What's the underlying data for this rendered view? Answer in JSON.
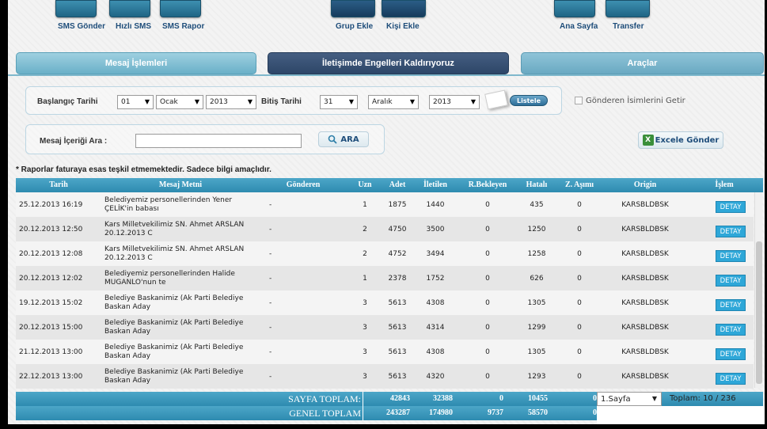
{
  "toolbar": {
    "sms_gonder": "SMS Gönder",
    "hizli_sms": "Hızlı SMS",
    "sms_rapor": "SMS Rapor",
    "grup_ekle": "Grup Ekle",
    "kisi_ekle": "Kişi Ekle",
    "ana_sayfa": "Ana Sayfa",
    "transfer": "Transfer"
  },
  "tabs": [
    {
      "label": "Mesaj İşlemleri"
    },
    {
      "label": "İletişimde Engelleri Kaldırıyoruz"
    },
    {
      "label": "Araçlar"
    }
  ],
  "filter": {
    "start_label": "Başlangıç Tarihi",
    "start_day": "01",
    "start_month": "Ocak",
    "start_year": "2013",
    "end_label": "Bitiş Tarihi",
    "end_day": "31",
    "end_month": "Aralık",
    "end_year": "2013",
    "list_button": "Listele",
    "sender_names_label": "Gönderen İsimlerini Getir",
    "search_label": "Mesaj İçeriği Ara :",
    "search_value": "",
    "search_button": "ARA",
    "excel_button": "Excele Gönder"
  },
  "note": "* Raporlar faturaya esas teşkil etmemektedir. Sadece bilgi amaçlıdır.",
  "table": {
    "headers": [
      "Tarih",
      "Mesaj Metni",
      "Gönderen",
      "Uzn",
      "Adet",
      "İletilen",
      "R.Bekleyen",
      "Hatalı",
      "Z. Aşımı",
      "Origin",
      "İşlem"
    ],
    "rows": [
      {
        "tarih": "25.12.2013 16:19",
        "mesaj": "Belediyemiz personellerinden Yener ÇELİK'in babası",
        "gonderen": "-",
        "uzn": "1",
        "adet": "1875",
        "iletilen": "1440",
        "bekleyen": "0",
        "hatali": "435",
        "zasimi": "0",
        "origin": "KARSBLDBSK",
        "islem": "DETAY"
      },
      {
        "tarih": "20.12.2013 12:50",
        "mesaj": "Kars Milletvekilimiz SN. Ahmet ARSLAN 20.12.2013 C",
        "gonderen": "-",
        "uzn": "2",
        "adet": "4750",
        "iletilen": "3500",
        "bekleyen": "0",
        "hatali": "1250",
        "zasimi": "0",
        "origin": "KARSBLDBSK",
        "islem": "DETAY"
      },
      {
        "tarih": "20.12.2013 12:08",
        "mesaj": "Kars Milletvekilimiz SN. Ahmet ARSLAN 20.12.2013 C",
        "gonderen": "-",
        "uzn": "2",
        "adet": "4752",
        "iletilen": "3494",
        "bekleyen": "0",
        "hatali": "1258",
        "zasimi": "0",
        "origin": "KARSBLDBSK",
        "islem": "DETAY"
      },
      {
        "tarih": "20.12.2013 12:02",
        "mesaj": "Belediyemiz personellerinden Halide MUGANLO'nun te",
        "gonderen": "-",
        "uzn": "1",
        "adet": "2378",
        "iletilen": "1752",
        "bekleyen": "0",
        "hatali": "626",
        "zasimi": "0",
        "origin": "KARSBLDBSK",
        "islem": "DETAY"
      },
      {
        "tarih": "19.12.2013 15:02",
        "mesaj": "Belediye Baskanimiz (Ak Parti Belediye Baskan Aday",
        "gonderen": "-",
        "uzn": "3",
        "adet": "5613",
        "iletilen": "4308",
        "bekleyen": "0",
        "hatali": "1305",
        "zasimi": "0",
        "origin": "KARSBLDBSK",
        "islem": "DETAY"
      },
      {
        "tarih": "20.12.2013 15:00",
        "mesaj": "Belediye Baskanimiz (Ak Parti Belediye Baskan Aday",
        "gonderen": "-",
        "uzn": "3",
        "adet": "5613",
        "iletilen": "4314",
        "bekleyen": "0",
        "hatali": "1299",
        "zasimi": "0",
        "origin": "KARSBLDBSK",
        "islem": "DETAY"
      },
      {
        "tarih": "21.12.2013 13:00",
        "mesaj": "Belediye Baskanimiz (Ak Parti Belediye Baskan Aday",
        "gonderen": "-",
        "uzn": "3",
        "adet": "5613",
        "iletilen": "4308",
        "bekleyen": "0",
        "hatali": "1305",
        "zasimi": "0",
        "origin": "KARSBLDBSK",
        "islem": "DETAY"
      },
      {
        "tarih": "22.12.2013 13:00",
        "mesaj": "Belediye Baskanimiz (Ak Parti Belediye Baskan Aday",
        "gonderen": "-",
        "uzn": "3",
        "adet": "5613",
        "iletilen": "4320",
        "bekleyen": "0",
        "hatali": "1293",
        "zasimi": "0",
        "origin": "KARSBLDBSK",
        "islem": "DETAY"
      }
    ]
  },
  "totals": {
    "page_label": "SAYFA TOPLAM:",
    "page_adet": "42843",
    "page_iletilen": "32388",
    "page_bekleyen": "0",
    "page_hatali": "10455",
    "page_zasimi": "0",
    "general_label": "GENEL TOPLAM",
    "general_adet": "243287",
    "general_iletilen": "174980",
    "general_bekleyen": "9737",
    "general_hatali": "58570",
    "general_zasimi": "0"
  },
  "pager": {
    "selected": "1.Sayfa",
    "total_text": "Toplam: 10 / 236"
  },
  "colors": {
    "header_blue": "#2e8bb0",
    "detay_blue": "#2ea7d8",
    "tab_dark": "#2d4668"
  }
}
